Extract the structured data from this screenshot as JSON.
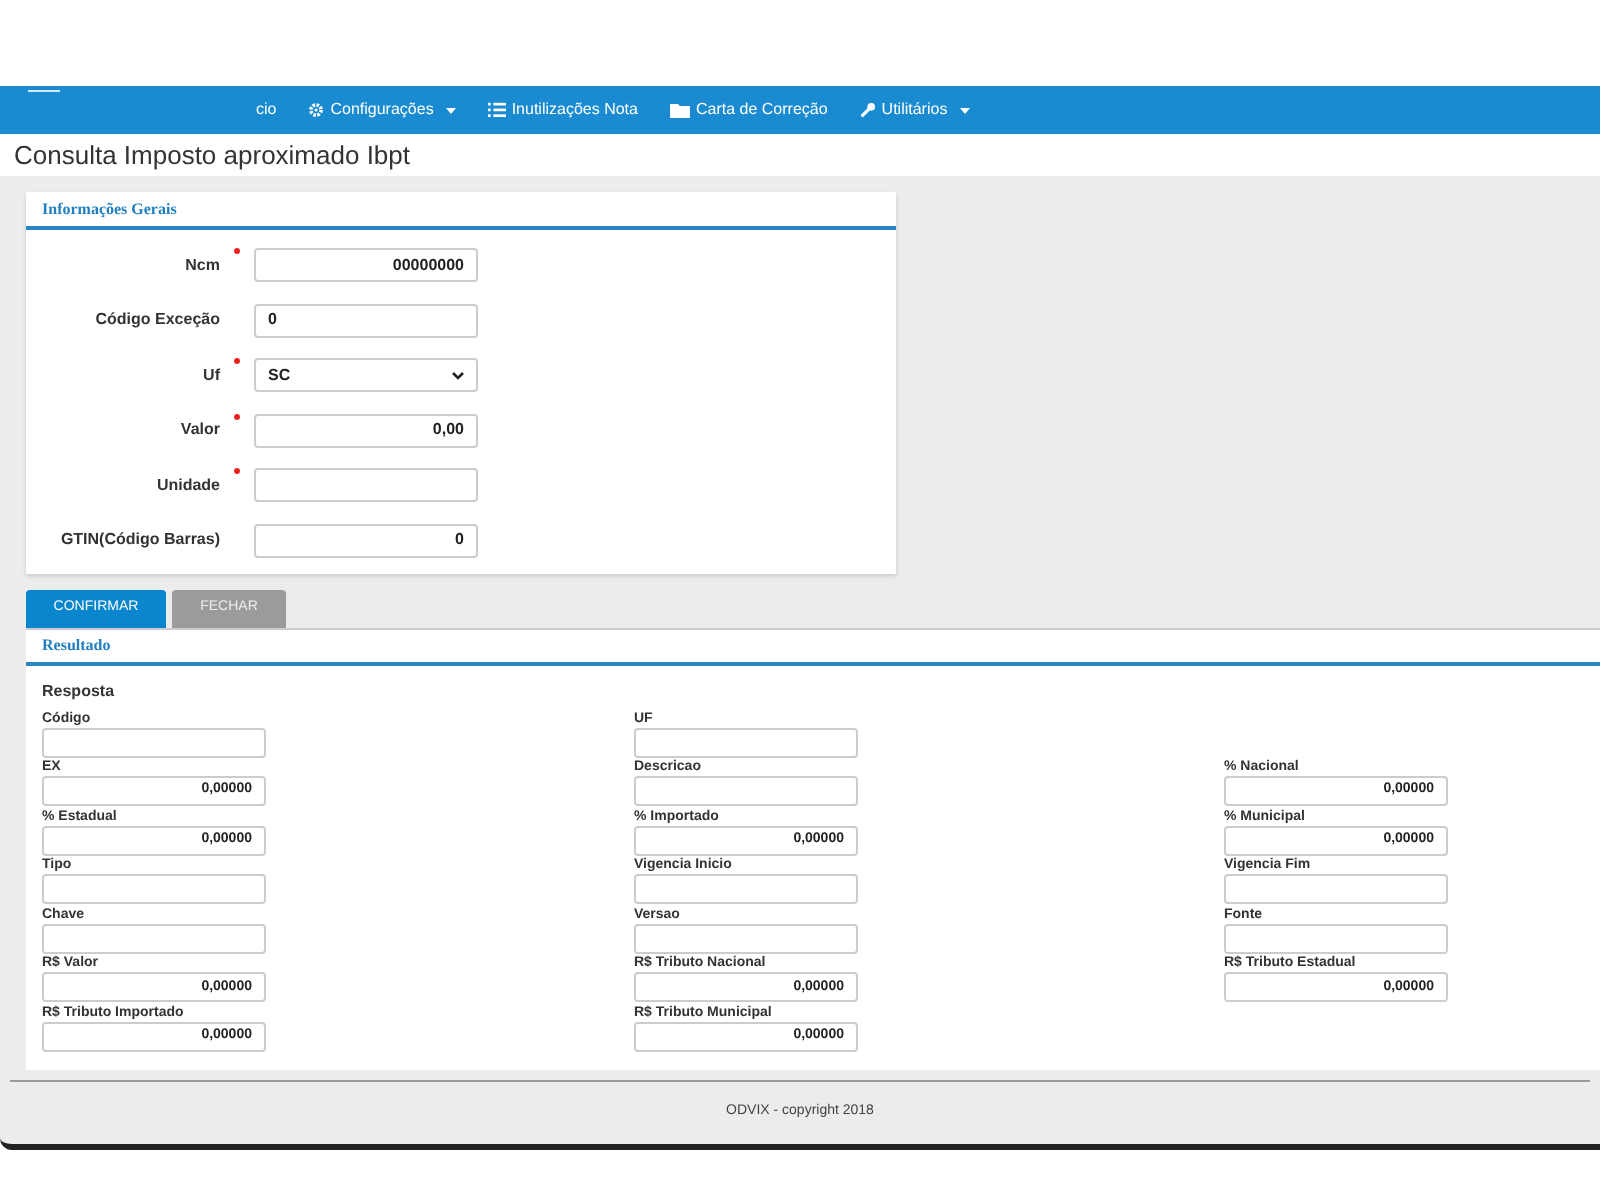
{
  "nav": {
    "items": [
      {
        "label": "cio",
        "caret": false
      },
      {
        "label": "Configurações",
        "caret": true
      },
      {
        "label": "Inutilizações Nota",
        "caret": false
      },
      {
        "label": "Carta de Correção",
        "caret": false
      },
      {
        "label": "Utilitários",
        "caret": true
      }
    ]
  },
  "page_title": "Consulta Imposto aproximado Ibpt",
  "general": {
    "title": "Informações Gerais",
    "fields": [
      {
        "label": "Ncm",
        "required": true,
        "kind": "number",
        "value": "00000000"
      },
      {
        "label": "Código Exceção",
        "required": false,
        "kind": "text",
        "value": "0"
      },
      {
        "label": "Uf",
        "required": true,
        "kind": "select",
        "value": "SC"
      },
      {
        "label": "Valor",
        "required": true,
        "kind": "number",
        "value": "0,00"
      },
      {
        "label": "Unidade",
        "required": true,
        "kind": "text"
      },
      {
        "label": "GTIN(Código Barras)",
        "required": false,
        "kind": "number",
        "value": "0"
      }
    ]
  },
  "buttons": [
    {
      "label": "CONFIRMAR",
      "kind": "primary"
    },
    {
      "label": "FECHAR",
      "kind": "secondary"
    }
  ],
  "result": {
    "title": "Resultado",
    "subtitle": "Resposta",
    "rows": [
      [
        {
          "label": "Código"
        },
        {
          "label": "UF"
        }
      ],
      [
        {
          "label": "EX",
          "value": "0,00000"
        },
        {
          "label": "Descricao"
        },
        {
          "label": "% Nacional",
          "value": "0,00000"
        }
      ],
      [
        {
          "label": "% Estadual",
          "value": "0,00000"
        },
        {
          "label": "% Importado",
          "value": "0,00000"
        },
        {
          "label": "% Municipal",
          "value": "0,00000"
        }
      ],
      [
        {
          "label": "Tipo"
        },
        {
          "label": "Vigencia Inicio"
        },
        {
          "label": "Vigencia Fim"
        }
      ],
      [
        {
          "label": "Chave"
        },
        {
          "label": "Versao"
        },
        {
          "label": "Fonte"
        }
      ],
      [
        {
          "label": "R$ Valor",
          "value": "0,00000"
        },
        {
          "label": "R$ Tributo Nacional",
          "value": "0,00000"
        },
        {
          "label": "R$ Tributo Estadual",
          "value": "0,00000"
        }
      ],
      [
        {
          "label": "R$ Tributo Importado",
          "value": "0,00000"
        },
        {
          "label": "R$ Tributo Municipal",
          "value": "0,00000"
        }
      ]
    ]
  },
  "footer": "ODVIX - copyright 2018"
}
